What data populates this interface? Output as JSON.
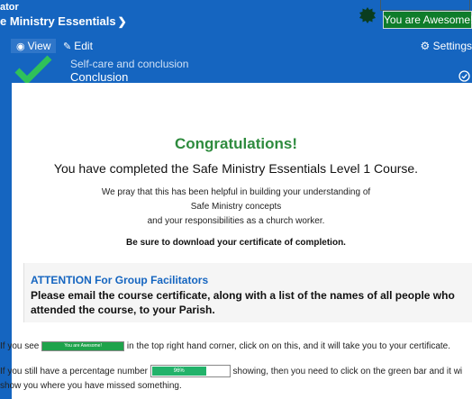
{
  "header": {
    "course_label": "ator",
    "course_title": "e Ministry Essentials",
    "awesome_label": "You are Awesome!"
  },
  "lesson_bar": {
    "tabs": [
      {
        "label": "View",
        "active": true
      },
      {
        "label": "Edit",
        "active": false
      }
    ],
    "settings_label": "Settings",
    "lesson_subtitle": "Self-care and conclusion",
    "lesson_title": "Conclusion"
  },
  "content": {
    "heading": "Congratulations!",
    "completed": "You have completed the Safe Ministry Essentials Level 1 Course.",
    "pray_lines": [
      "We pray that this has been helpful in building your understanding of",
      "Safe Ministry concepts",
      "and your responsibilities as a church worker."
    ],
    "download": "Be sure to download your certificate of completion.",
    "attention_title": "ATTENTION For Group Facilitators",
    "attention_body": "Please email the course certificate, along with a list of the names of all people who attended the course, to your Parish.",
    "p1_before": "If you see",
    "p1_button": "You are Awesome!",
    "p1_after": "in the top right hand corner, click on on this, and it will take you to your certificate.",
    "p2_before": "If you still have a percentage number",
    "p2_bar": "96%",
    "p2_after": "showing, then you need to click on the green bar and it wi",
    "p3": "show you where you have missed something."
  },
  "colors": {
    "primary": "#1565c0",
    "awesome_green": "#0e7c2a",
    "congrats_green": "#2e8b3e",
    "attention_blue": "#1565c0"
  },
  "icons": {
    "badge": "seal-badge-icon",
    "view": "eye-icon",
    "edit": "pencil-icon",
    "settings": "gears-icon",
    "complete": "green-check-icon",
    "lesson_done": "circle-check-icon"
  }
}
